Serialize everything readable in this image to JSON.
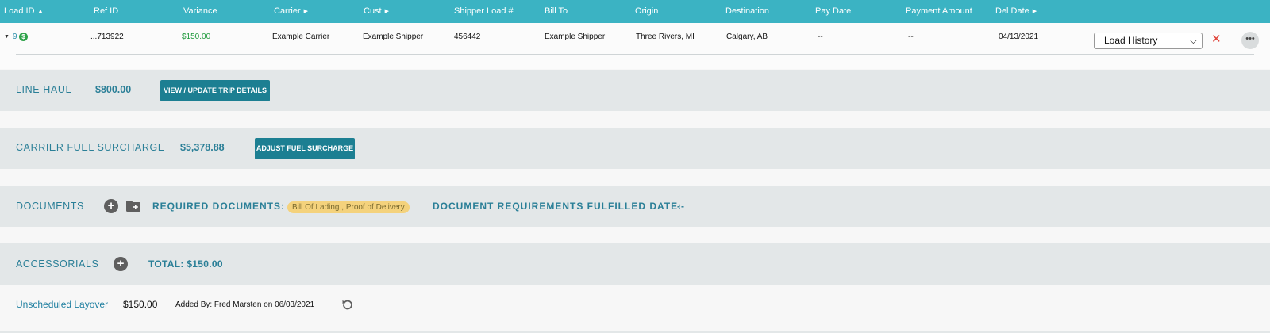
{
  "header": {
    "columns": [
      {
        "label": "Load ID",
        "caret": "▲"
      },
      {
        "label": "Ref ID",
        "caret": ""
      },
      {
        "label": "Variance",
        "caret": ""
      },
      {
        "label": "Carrier",
        "caret": "▶"
      },
      {
        "label": "Cust",
        "caret": "▶"
      },
      {
        "label": "Shipper Load #",
        "caret": ""
      },
      {
        "label": "Bill To",
        "caret": ""
      },
      {
        "label": "Origin",
        "caret": ""
      },
      {
        "label": "Destination",
        "caret": ""
      },
      {
        "label": "Pay Date",
        "caret": ""
      },
      {
        "label": "Payment Amount",
        "caret": ""
      },
      {
        "label": "Del Date",
        "caret": "▶"
      }
    ]
  },
  "row": {
    "load_id": "9",
    "ref_id": "...713922",
    "variance": "$150.00",
    "carrier": "Example Carrier",
    "cust": "Example Shipper",
    "shipper_load": "456442",
    "bill_to": "Example Shipper",
    "origin": "Three Rivers, MI",
    "destination": "Calgary, AB",
    "pay_date": "--",
    "payment_amount": "--",
    "del_date": "04/13/2021",
    "history_select": "Load History"
  },
  "line_haul": {
    "label": "LINE HAUL",
    "value": "$800.00",
    "button": "VIEW / UPDATE TRIP DETAILS"
  },
  "fuel": {
    "label": "CARRIER FUEL SURCHARGE",
    "value": "$5,378.88",
    "button": "ADJUST FUEL SURCHARGE"
  },
  "documents": {
    "label": "DOCUMENTS",
    "required_label": "REQUIRED DOCUMENTS:",
    "required_value": "Bill Of Lading , Proof of Delivery",
    "fulfilled_label": "DOCUMENT REQUIREMENTS FULFILLED DATE:",
    "fulfilled_value": "--"
  },
  "accessorials": {
    "label": "ACCESSORIALS",
    "total": "TOTAL: $150.00",
    "items": [
      {
        "name": "Unscheduled Layover",
        "amount": "$150.00",
        "added_by": "Added By: Fred Marsten on 06/03/2021"
      }
    ]
  },
  "colors": {
    "header": "#3bb3c3",
    "accent": "#2a7f97",
    "button": "#1c7f92",
    "variance": "#1f9a3c",
    "delete": "#e0443a"
  }
}
